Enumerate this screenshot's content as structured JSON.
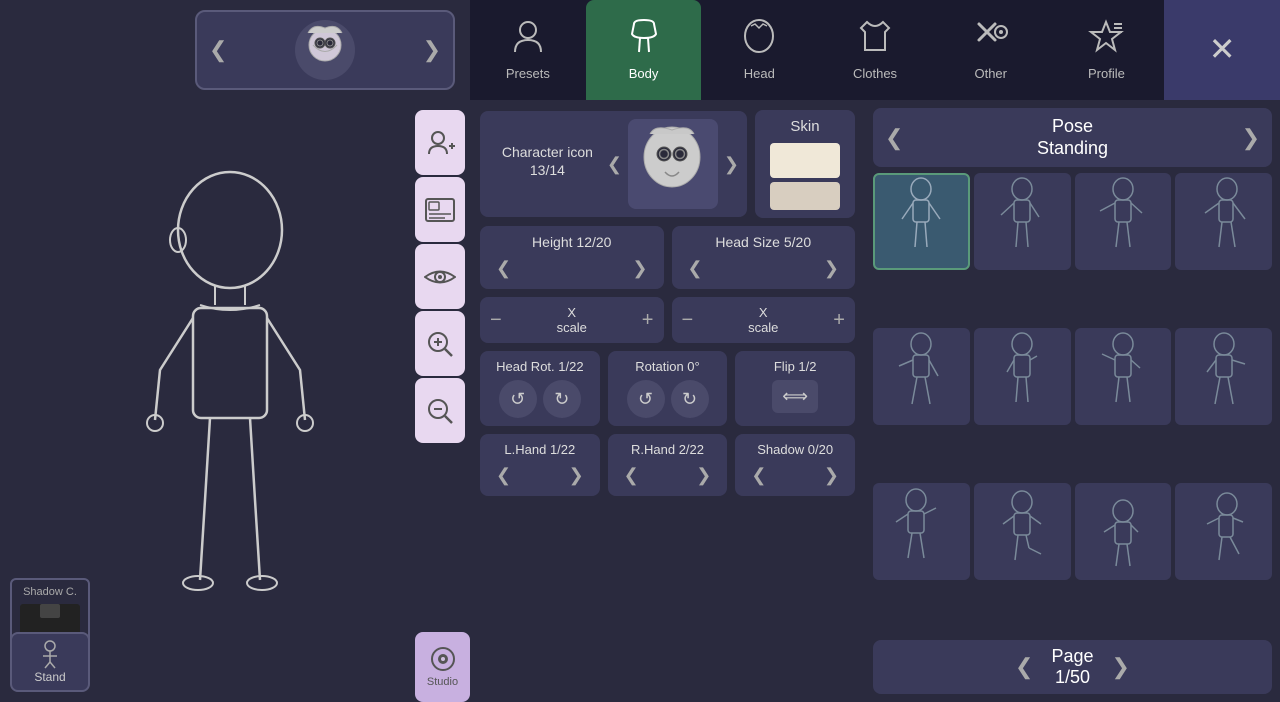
{
  "tabs": [
    {
      "id": "presets",
      "label": "Presets",
      "icon": "👤",
      "active": false
    },
    {
      "id": "body",
      "label": "Body",
      "icon": "🧥",
      "active": true
    },
    {
      "id": "head",
      "label": "Head",
      "icon": "😈",
      "active": false
    },
    {
      "id": "clothes",
      "label": "Clothes",
      "icon": "👕",
      "active": false
    },
    {
      "id": "other",
      "label": "Other",
      "icon": "⚔️",
      "active": false
    },
    {
      "id": "profile",
      "label": "Profile",
      "icon": "⭐",
      "active": false
    }
  ],
  "controls": {
    "char_icon_label": "Character icon 13/14",
    "skin_label": "Skin",
    "height_label": "Height 12/20",
    "head_size_label": "Head Size 5/20",
    "head_rot_label": "Head Rot. 1/22",
    "rotation_label": "Rotation 0°",
    "flip_label": "Flip 1/2",
    "lhand_label": "L.Hand 1/22",
    "rhand_label": "R.Hand 2/22",
    "shadow_label": "Shadow 0/20",
    "x_scale": "X\nscale"
  },
  "pose": {
    "title": "Pose\nStanding",
    "page": "Page\n1/50"
  },
  "sidebar": {
    "shadow_label": "Shadow C.",
    "stand_label": "Stand",
    "studio_label": "Studio"
  },
  "nav": {
    "left_arrow": "❮",
    "right_arrow": "❯"
  }
}
